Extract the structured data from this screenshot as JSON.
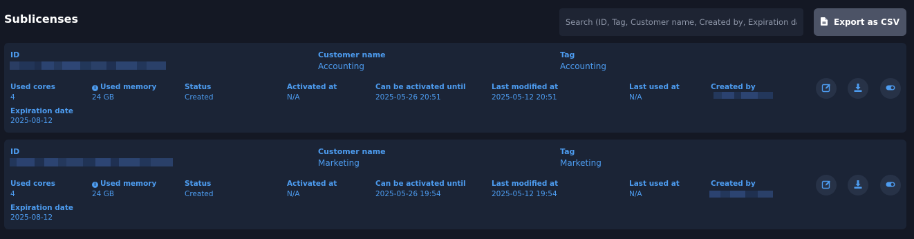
{
  "page": {
    "title": "Sublicenses"
  },
  "search": {
    "placeholder": "Search (ID, Tag, Customer name, Created by, Expiration date)"
  },
  "toolbar": {
    "export_label": "Export as CSV",
    "export_icon": "csv-file-icon"
  },
  "labels": {
    "id": "ID",
    "customer_name": "Customer name",
    "tag": "Tag",
    "used_cores": "Used cores",
    "used_memory": "Used memory",
    "status": "Status",
    "activated_at": "Activated at",
    "can_be_activated_until": "Can be activated until",
    "last_modified_at": "Last modified at",
    "last_used_at": "Last used at",
    "created_by": "Created by",
    "expiration_date": "Expiration date"
  },
  "actions": {
    "edit_icon": "edit-icon",
    "download_icon": "download-icon",
    "toggle_icon": "toggle-icon"
  },
  "colors": {
    "background": "#141824",
    "card": "#1b2436",
    "accent": "#4d9cf0",
    "button": "#4c5366"
  },
  "sublicenses": [
    {
      "id": "",
      "customer_name": "Accounting",
      "tag": "Accounting",
      "used_cores": "4",
      "used_memory": "24 GB",
      "status": "Created",
      "activated_at": "N/A",
      "can_be_activated_until": "2025-05-26 20:51",
      "last_modified_at": "2025-05-12 20:51",
      "last_used_at": "N/A",
      "created_by": "",
      "expiration_date": "2025-08-12"
    },
    {
      "id": "",
      "customer_name": "Marketing",
      "tag": "Marketing",
      "used_cores": "4",
      "used_memory": "24 GB",
      "status": "Created",
      "activated_at": "N/A",
      "can_be_activated_until": "2025-05-26 19:54",
      "last_modified_at": "2025-05-12 19:54",
      "last_used_at": "N/A",
      "created_by": "",
      "expiration_date": "2025-08-12"
    }
  ]
}
